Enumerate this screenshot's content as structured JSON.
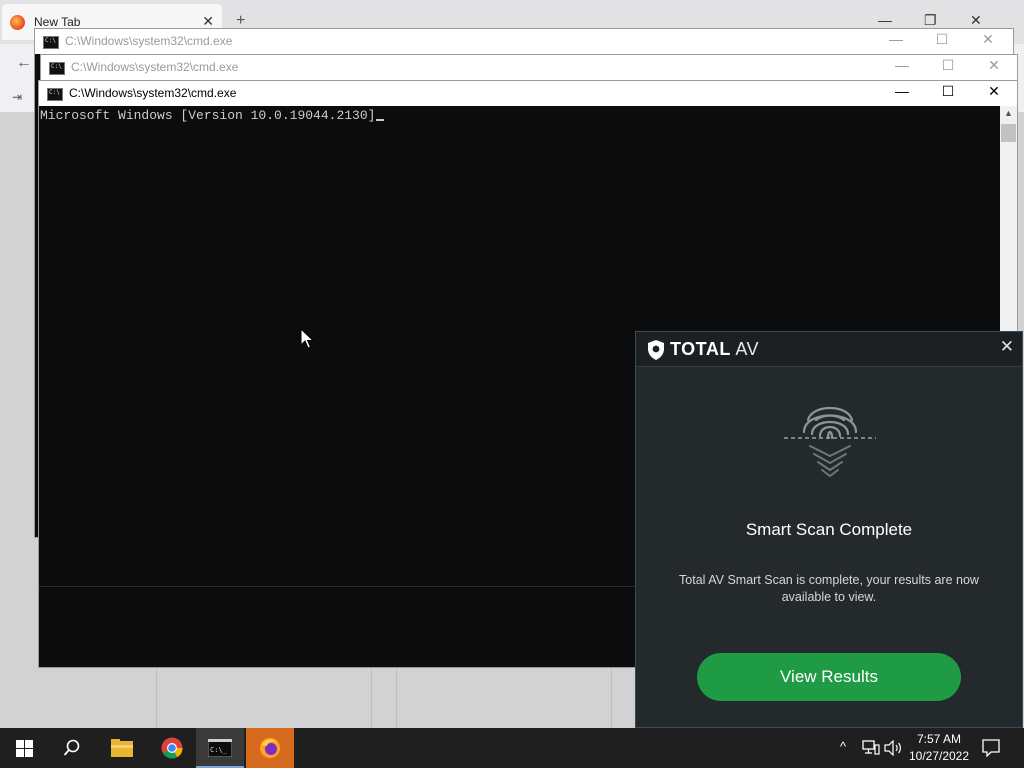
{
  "firefox": {
    "tab_title": "New Tab",
    "tab_close": "✕",
    "new_tab": "+",
    "back": "←",
    "signin": "⇥",
    "min": "—",
    "restore": "❐",
    "close": "✕"
  },
  "cmd_windows": [
    {
      "title": "C:\\Windows\\system32\\cmd.exe",
      "state": "inactive"
    },
    {
      "title": "C:\\Windows\\system32\\cmd.exe",
      "state": "inactive"
    },
    {
      "title": "C:\\Windows\\system32\\cmd.exe",
      "state": "active"
    }
  ],
  "window_buttons": {
    "minimize": "—",
    "maximize": "☐",
    "close": "✕"
  },
  "console": {
    "text": "Microsoft Windows [Version 10.0.19044.2130]"
  },
  "scrollbar": {
    "up_arrow": "▲"
  },
  "totalav": {
    "brand_bold": "TOTAL",
    "brand_light": "AV",
    "close": "✕",
    "heading": "Smart Scan Complete",
    "body": "Total AV Smart Scan is complete, your results are now available to view.",
    "button": "View Results",
    "colors": {
      "background": "#24292c",
      "button": "#209b45"
    }
  },
  "taskbar": {
    "items": [
      "start-icon",
      "search-icon",
      "file-explorer-icon",
      "chrome-icon",
      "cmd-icon",
      "firefox-icon"
    ],
    "tray_chevron": "^",
    "time": "7:57 AM",
    "date": "10/27/2022"
  }
}
